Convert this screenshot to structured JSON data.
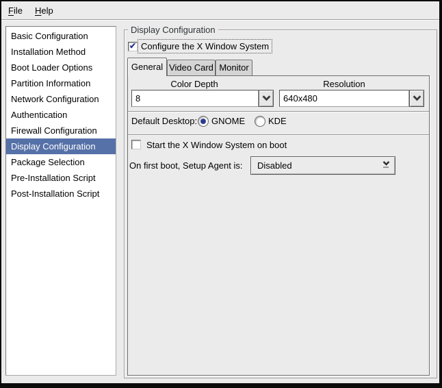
{
  "menu": {
    "items": [
      {
        "label": "File",
        "mnemonic": "F",
        "rest": "ile"
      },
      {
        "label": "Help",
        "mnemonic": "H",
        "rest": "elp"
      }
    ]
  },
  "sidebar": {
    "items": [
      "Basic Configuration",
      "Installation Method",
      "Boot Loader Options",
      "Partition Information",
      "Network Configuration",
      "Authentication",
      "Firewall Configuration",
      "Display Configuration",
      "Package Selection",
      "Pre-Installation Script",
      "Post-Installation Script"
    ],
    "selected": "Display Configuration",
    "selected_index": 7
  },
  "panel": {
    "frame_title": "Display Configuration",
    "configure_x": {
      "label": "Configure the X Window System",
      "checked": true
    },
    "tabs": [
      {
        "label": "General",
        "active": true
      },
      {
        "label": "Video Card",
        "active": false
      },
      {
        "label": "Monitor",
        "active": false
      }
    ],
    "general": {
      "color_depth": {
        "label": "Color Depth",
        "value": "8"
      },
      "resolution": {
        "label": "Resolution",
        "value": "640x480"
      },
      "default_desktop": {
        "label": "Default Desktop:",
        "options": [
          {
            "label": "GNOME",
            "selected": true
          },
          {
            "label": "KDE",
            "selected": false
          }
        ]
      },
      "start_x": {
        "label": "Start the X Window System on boot",
        "checked": false
      },
      "setup_agent": {
        "label": "On first boot, Setup Agent is:",
        "value": "Disabled"
      }
    }
  },
  "icons": {
    "checkmark": "✔"
  },
  "colors": {
    "selection": "#5671a8",
    "check_accent": "#2c3990",
    "window_bg": "#ebebeb",
    "inactive_tab_bg": "#d4d4d4"
  }
}
